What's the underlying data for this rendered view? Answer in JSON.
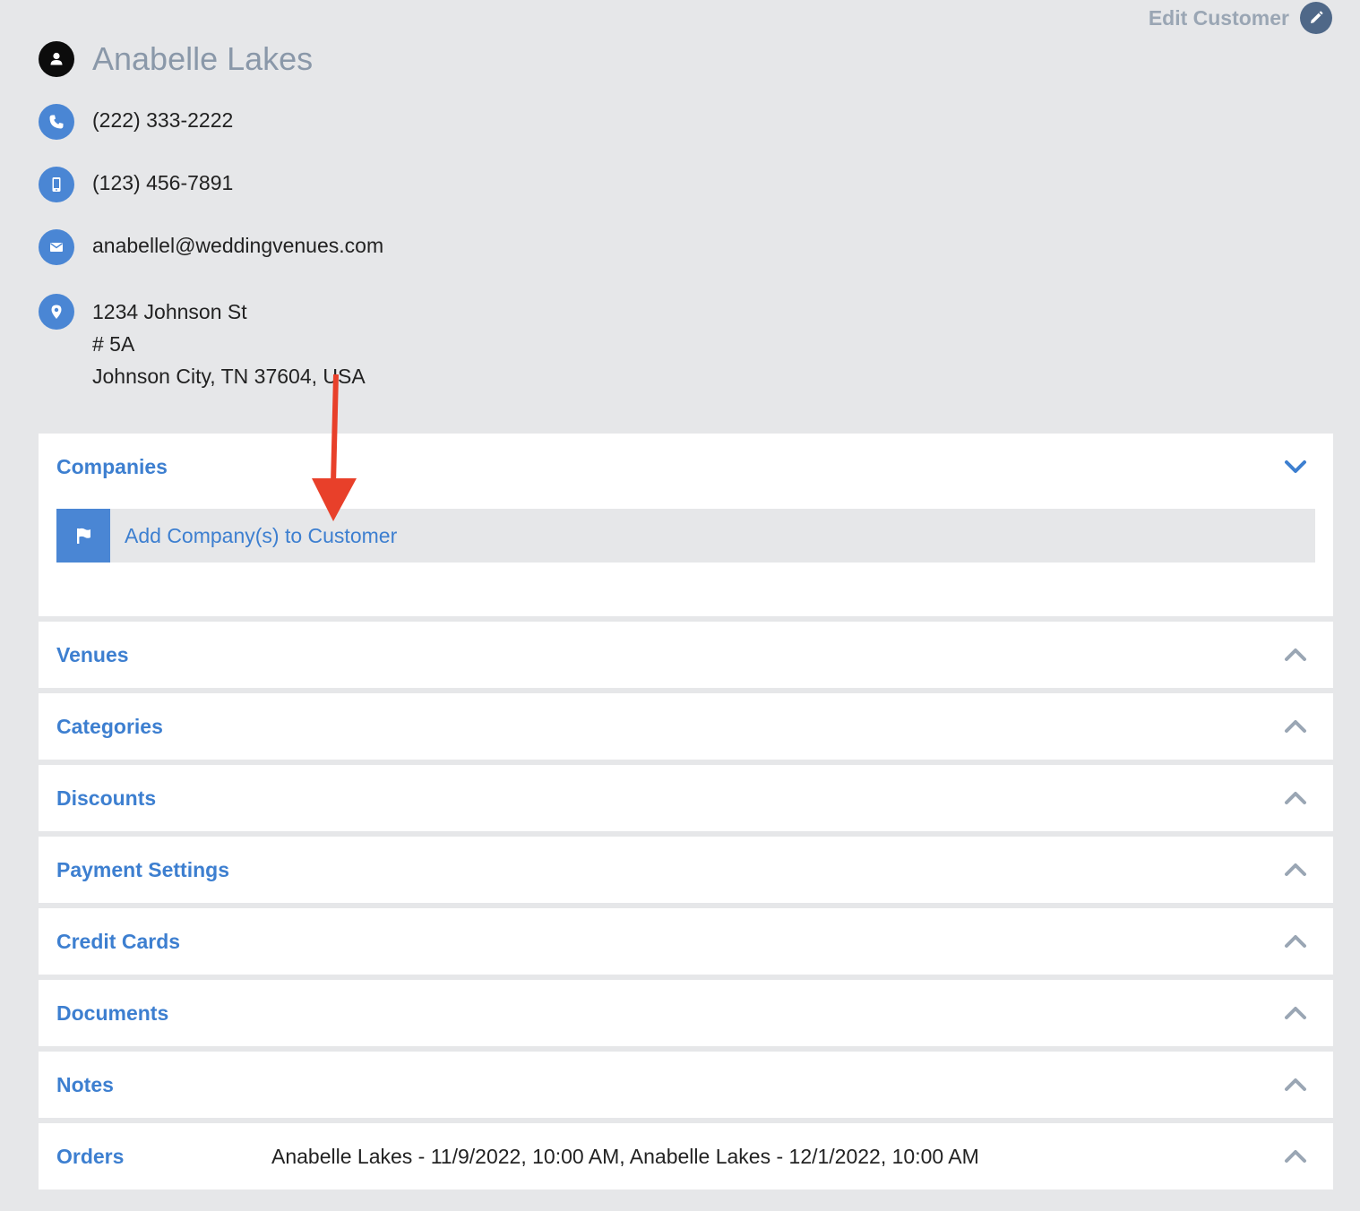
{
  "header": {
    "edit_label": "Edit Customer"
  },
  "customer": {
    "name": "Anabelle Lakes",
    "phone": "(222) 333-2222",
    "mobile": "(123) 456-7891",
    "email": "anabellel@weddingvenues.com",
    "address_line1": "1234 Johnson St",
    "address_line2": "# 5A",
    "address_line3": "Johnson City, TN 37604, USA"
  },
  "icons": {
    "name": "person-icon",
    "phone": "phone-icon",
    "mobile": "mobile-phone-icon",
    "email": "envelope-icon",
    "address": "map-pin-icon",
    "edit": "pencil-icon",
    "add_company": "flag-icon",
    "expanded": "chevron-down-icon",
    "collapsed": "chevron-up-icon"
  },
  "colors": {
    "accent": "#3d7fd0",
    "icon_bg": "#4a86d4",
    "background": "#e6e7e9",
    "annotation_arrow": "#e8402a"
  },
  "sections": {
    "companies": {
      "title": "Companies",
      "add_label": "Add Company(s) to Customer",
      "expanded": true
    },
    "venues": {
      "title": "Venues",
      "expanded": false
    },
    "categories": {
      "title": "Categories",
      "expanded": false
    },
    "discounts": {
      "title": "Discounts",
      "expanded": false
    },
    "payment_settings": {
      "title": "Payment Settings",
      "expanded": false
    },
    "credit_cards": {
      "title": "Credit Cards",
      "expanded": false
    },
    "documents": {
      "title": "Documents",
      "expanded": false
    },
    "notes": {
      "title": "Notes",
      "expanded": false
    },
    "orders": {
      "title": "Orders",
      "summary": "Anabelle Lakes - 11/9/2022, 10:00 AM, Anabelle Lakes - 12/1/2022, 10:00 AM",
      "expanded": false
    }
  }
}
